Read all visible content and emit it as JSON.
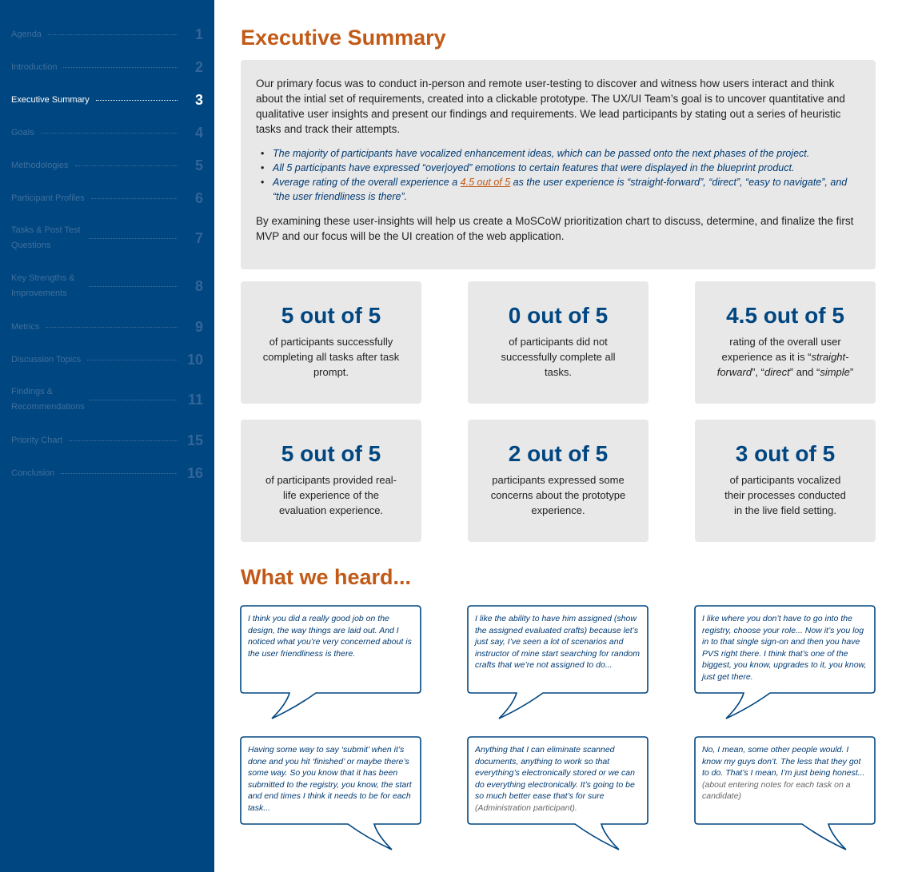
{
  "sidebar": {
    "items": [
      {
        "label": "Agenda",
        "num": "1"
      },
      {
        "label": "Introduction",
        "num": "2"
      },
      {
        "label": "Executive Summary",
        "num": "3"
      },
      {
        "label": "Goals",
        "num": "4"
      },
      {
        "label": "Methodologies",
        "num": "5"
      },
      {
        "label": "Participant Profiles",
        "num": "6"
      },
      {
        "label": "Tasks & Post Test Questions",
        "num": "7"
      },
      {
        "label": "Key Strengths & Improvements",
        "num": "8"
      },
      {
        "label": "Metrics",
        "num": "9"
      },
      {
        "label": "Discussion Topics",
        "num": "10"
      },
      {
        "label": "Findings & Recommendations",
        "num": "11"
      },
      {
        "label": "Priority Chart",
        "num": "15"
      },
      {
        "label": "Conclusion",
        "num": "16"
      }
    ],
    "active_index": 2,
    "colors": {
      "background": "#004680",
      "inactive_text": "#3f6f9c",
      "active_text": "#ffffff"
    }
  },
  "main": {
    "title": "Executive Summary",
    "summary": {
      "intro": "Our primary focus was to conduct in-person and remote user-testing to discover and witness how users interact and think about the intial set of requirements, created into a clickable prototype. The UX/UI Team’s goal is to uncover quantitative and qualitative user insights and present our findings and requirements. We lead participants by stating out a series of heuristic tasks and track their attempts.",
      "bullets": [
        "The majority of participants have vocalized enhancement ideas, which can be passed onto the next phases of the project.",
        "All 5 participants have expressed “overjoyed” emotions to certain features that were displayed in the blueprint product."
      ],
      "bullet3_pre": "Average rating of the overall experience a ",
      "bullet3_highlight": "4.5 out of 5",
      "bullet3_post": " as the user experience is “straight-forward”, “direct”, “easy to navigate”, and “the user friendliness is there”.",
      "closing": "By examining these user-insights will help us create a MoSCoW prioritization chart to discuss, determine, and finalize the first MVP and our focus will be the UI creation of the web application."
    },
    "stats": [
      {
        "value": "5 out of 5",
        "desc": "of participants successfully completing all tasks after task prompt."
      },
      {
        "value": "0 out of 5",
        "desc": "of participants did not successfully complete all tasks."
      },
      {
        "value": "4.5 out of 5",
        "desc_pre": "rating of the overall user experience as it is “",
        "desc_i1": "straight-forward",
        "desc_mid1": "”, “",
        "desc_i2": "direct",
        "desc_mid2": "” and “",
        "desc_i3": "simple",
        "desc_post": "”"
      },
      {
        "value": "5 out of 5",
        "desc": "of participants provided real-life experience of the evaluation experience."
      },
      {
        "value": "2 out of 5",
        "desc": "participants expressed some concerns about the prototype experience."
      },
      {
        "value": "3 out of 5",
        "desc": "of participants vocalized their processes conducted in the live field setting."
      }
    ],
    "heard_title": "What we heard...",
    "quotes": [
      {
        "text": " I think you did a really good job on the design, the way things are laid out. And I noticed what you’re very concerned about is the user friendliness is there."
      },
      {
        "text": "I like the ability to have him assigned (show the assigned evaluated crafts) because let’s just say, I’ve seen a lot of scenarios and instructor of mine start searching for random crafts that we’re not assigned to do..."
      },
      {
        "text": "I like where you don’t have to go into the registry, choose your role... Now it’s you log in to that single sign-on and then you have PVS right there. I think that’s one of the biggest, you know, upgrades to it, you know, just get there."
      },
      {
        "text": "Having some way to say ‘submit’ when it’s done and you hit ‘finished’ or maybe there’s some way. So you know that it has been submitted to the registry, you know, the start and end times I think it needs to be for each task..."
      },
      {
        "text": "Anything that I can eliminate scanned documents, anything to work so that everything’s electronically stored or we can do everything electronically. It’s going to be so much better ease that’s for sure ",
        "note": "(Administration participant)."
      },
      {
        "text": "No, I mean, some other people would. I know my guys don’t. The less that they got to do. That’s I mean, I’m just being honest... ",
        "note": "(about entering notes for each task on a candidate)"
      }
    ],
    "colors": {
      "accent": "#c25a17",
      "navy": "#004680",
      "panel": "#e8e8e8"
    }
  }
}
